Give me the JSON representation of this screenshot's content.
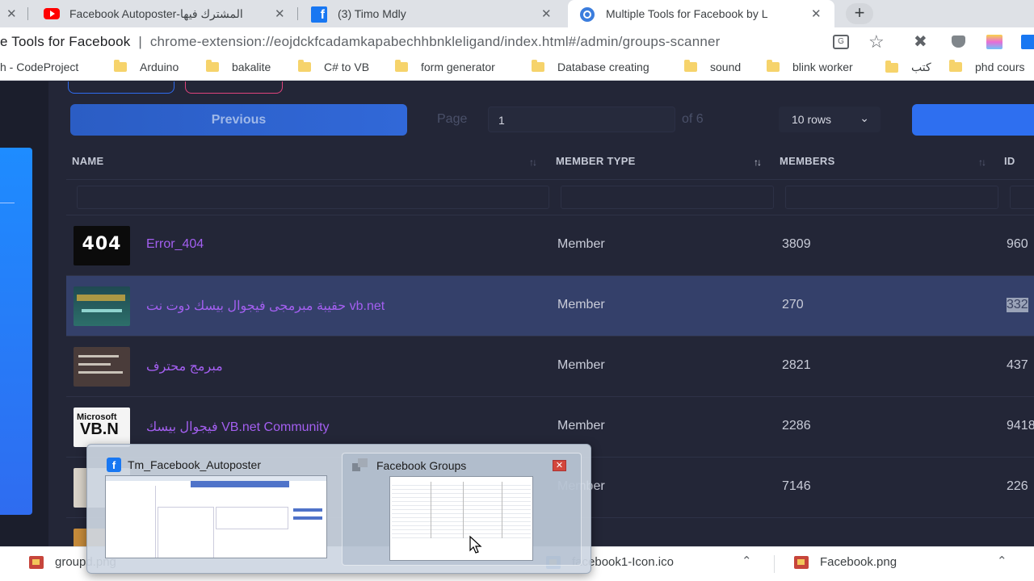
{
  "tabs": [
    {
      "title": "Facebook Autoposter-المشترك فيها",
      "icon": "youtube-icon"
    },
    {
      "title": "(3) Timo Mdly",
      "icon": "facebook-icon"
    },
    {
      "title": "Multiple Tools for Facebook by L",
      "icon": "extension-icon"
    }
  ],
  "address": {
    "site_label": "e Tools for Facebook",
    "url": "chrome-extension://eojdckfcadamkapabechhbnkleligand/index.html#/admin/groups-scanner"
  },
  "bookmarks": [
    "h - CodeProject",
    "Arduino",
    "bakalite",
    "C# to VB",
    "form generator",
    "Database creating",
    "sound",
    "blink worker",
    "كتب",
    "phd cours"
  ],
  "pagination": {
    "previous_label": "Previous",
    "page_label": "Page",
    "page_value": "1",
    "of_label": "of 6",
    "rows_label": "10 rows"
  },
  "table": {
    "headers": [
      "NAME",
      "MEMBER TYPE",
      "MEMBERS",
      "ID"
    ],
    "rows": [
      {
        "name": "Error_404",
        "type": "Member",
        "members": "3809",
        "id": "960"
      },
      {
        "name": "حقيبة مبرمجى فيجوال بيسك دوت نت vb.net",
        "type": "Member",
        "members": "270",
        "id": "332"
      },
      {
        "name": "مبرمج محترف",
        "type": "Member",
        "members": "2821",
        "id": "437"
      },
      {
        "name": "فيجوال بيسك VB.net Community",
        "type": "Member",
        "members": "2286",
        "id": "9418"
      },
      {
        "name": "",
        "type": "Member",
        "members": "7146",
        "id": "226"
      }
    ]
  },
  "taskbar_popup": {
    "items": [
      "Tm_Facebook_Autoposter",
      "Facebook Groups"
    ]
  },
  "downloads": [
    "groupd.png",
    "facebook1-Icon.ico",
    "Facebook.png"
  ]
}
